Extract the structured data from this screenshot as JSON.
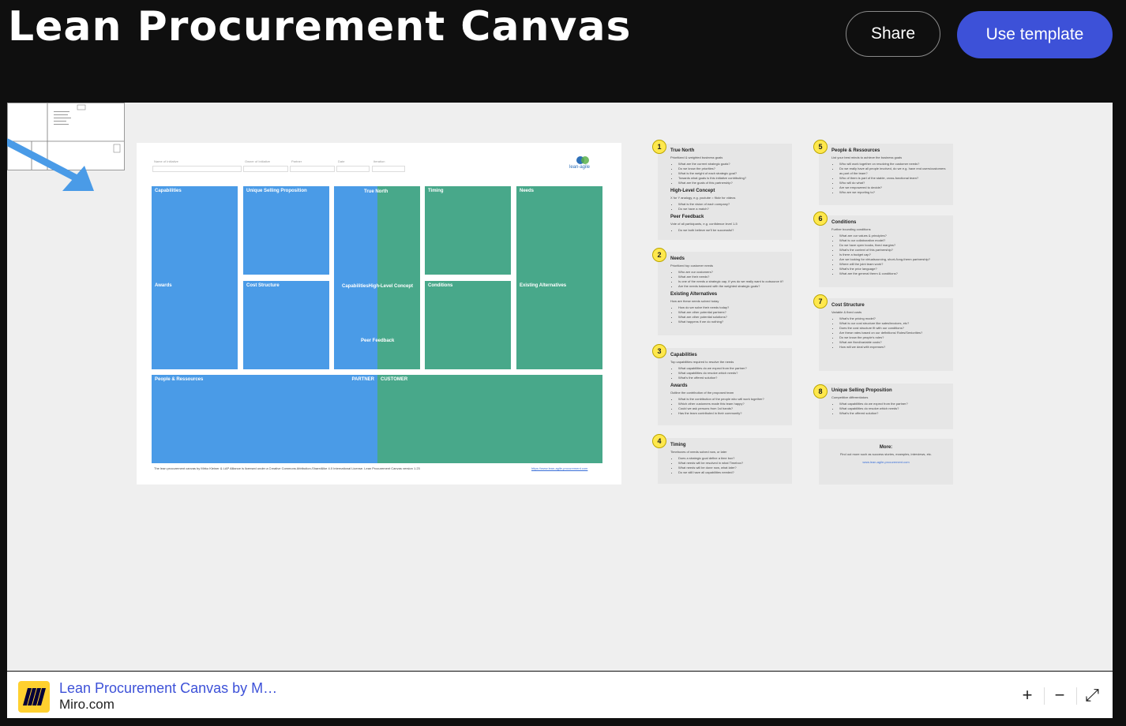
{
  "header": {
    "title": "Lean Procurement Canvas",
    "share_label": "Share",
    "use_template_label": "Use template"
  },
  "board": {
    "fields": [
      "Name of Initiative",
      "Owner of Initiative",
      "Partner",
      "Date",
      "Iteration"
    ],
    "logo_text": "lean-agile",
    "cells": {
      "capabilities": "Capabilities",
      "awards": "Awards",
      "usp": "Unique Selling Proposition",
      "cost_structure": "Cost Structure",
      "true_north": "True North",
      "capabilities_high_level": "CapabilitiesHigh-Level Concept",
      "peer_feedback": "Peer Feedback",
      "timing": "Timing",
      "conditions": "Conditions",
      "needs": "Needs",
      "existing_alternatives": "Existing Alternatives",
      "people_resources": "People & Ressources",
      "partner": "PARTNER",
      "customer": "CUSTOMER"
    },
    "footer_text": "The lean procurement canvas by Mirko Kleiner & LAP Alliance is licensed under a Creative Commons Attribution-ShareAlike 4.0 International License. Lean Procurement Canvas version 1.23",
    "footer_link": "https://www.lean-agile-procurement.com"
  },
  "notes": [
    {
      "num": "1",
      "sections": [
        {
          "title": "True North",
          "desc": "Prioritized & weighted business goals",
          "items": [
            "What are the current strategic goals?",
            "Do we know the priorities?",
            "What is the weight of each strategic goal?",
            "Towards what goals is this initiative contributing?",
            "What are the goals of this partnership?"
          ]
        },
        {
          "title": "High-Level Concept",
          "desc": "X for Y analogy, e.g. youtube = flickr for videos",
          "items": [
            "What is the vision of each company?",
            "Do we have a match?"
          ]
        },
        {
          "title": "Peer Feedback",
          "desc": "Vote of all participants, e.g. confidence level 1-5",
          "items": [
            "Do we both believe we'll be successful?"
          ]
        }
      ]
    },
    {
      "num": "2",
      "sections": [
        {
          "title": "Needs",
          "desc": "Prioritized top customer needs",
          "items": [
            "Who are our customers?",
            "What are their needs?",
            "Is one of the needs a strategic cap, if yes do we really want to outsource it?",
            "Are the needs balanced with the weighted strategic goals?"
          ]
        },
        {
          "title": "Existing Alternatives",
          "desc": "How are these needs solved today",
          "items": [
            "How do we solve their needs today?",
            "What are other potential partners?",
            "What are other potential solutions?",
            "What happens if we do nothing?"
          ]
        }
      ]
    },
    {
      "num": "3",
      "sections": [
        {
          "title": "Capabilities",
          "desc": "Top capabilities required to resolve the needs",
          "items": [
            "What capabilities do we expect from the partner?",
            "What capabilities do resolve which needs?",
            "What's the offered solution?"
          ]
        },
        {
          "title": "Awards",
          "desc": "Outline the contribution of the proposed team",
          "items": [
            "What is the contribution of the people who will work together?",
            "Which other customers made this team happy?",
            "Could we ask persons from 1st hands?",
            "Has the team contributed in their community?"
          ]
        }
      ]
    },
    {
      "num": "4",
      "sections": [
        {
          "title": "Timing",
          "desc": "Timeboxes of needs solved now, or later",
          "items": [
            "Does a strategic goal define a time box?",
            "What needs will be resolved in what Timebox?",
            "What needs will be done now, what later?",
            "Do we still have all capabilities needed?"
          ]
        }
      ]
    },
    {
      "num": "5",
      "sections": [
        {
          "title": "People & Ressources",
          "desc": "List your best minds to achieve the business goals",
          "items": [
            "Who will work together on resolving the customer needs?",
            "Do we really have all people involved, do we e.g. have end users/customers as part of the team?",
            "Who of them is part of the stable, cross-functional team?",
            "Who will do what?",
            "Are we empowered to decide?",
            "Who are we reporting to?"
          ]
        }
      ]
    },
    {
      "num": "6",
      "sections": [
        {
          "title": "Conditions",
          "desc": "Further bounding conditions",
          "items": [
            "What are our values & principles?",
            "What is our collaboration model?",
            "Do we have open books, fixed margins?",
            "What's the context of this partnership?",
            "Is there a budget cap?",
            "Are we looking for virtualsourcing, short-/long-therm partnership?",
            "Where will the joint team work?",
            "What's the prior language?",
            "What are the general therm & conditions?"
          ]
        }
      ]
    },
    {
      "num": "7",
      "sections": [
        {
          "title": "Cost Structure",
          "desc": "Variable & fixed costs",
          "items": [
            "What's the pricing model?",
            "What is our cost structure like sales/invoices, etc?",
            "Does the cost structure fit with our conditions?",
            "Are these rates based on our definitions/ Roles/Seniorities?",
            "Do we know the people's roles?",
            "What are fixed/variable costs?",
            "How will we deal with expenses?"
          ]
        }
      ]
    },
    {
      "num": "8",
      "sections": [
        {
          "title": "Unique Selling Proposition",
          "desc": "Competitive differentiators",
          "items": [
            "What capabilities do we expect from the partner?",
            "What capabilities do resolve which needs?",
            "What's the offered solution?"
          ]
        }
      ]
    }
  ],
  "more": {
    "title": "More:",
    "text": "Find out more such as success stories, examples, interviews, etc.",
    "link": "www.lean-agile-procurement.com"
  },
  "bottombar": {
    "title": "Lean Procurement Canvas by M…",
    "domain": "Miro.com",
    "zoom_in": "+",
    "zoom_out": "−",
    "fullscreen": "⤢"
  },
  "colors": {
    "blue_cell": "#4a9be7",
    "green_cell": "#48a88a",
    "accent": "#3d51d8",
    "note_badge": "#ffe84d"
  }
}
